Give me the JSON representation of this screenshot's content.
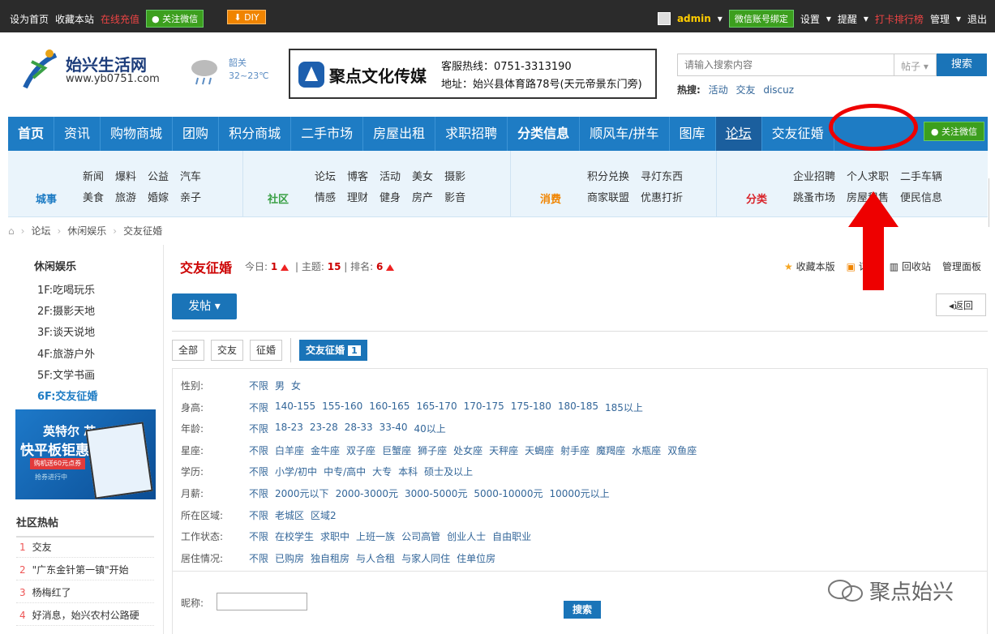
{
  "topbar": {
    "set_home": "设为首页",
    "favorite": "收藏本站",
    "recharge": "在线充值",
    "follow_wechat": "关注微信",
    "diy": "DIY",
    "username": "admin",
    "wechat_bind": "微信账号绑定",
    "settings": "设置",
    "remind": "提醒",
    "ranking": "打卡排行榜",
    "manage": "管理",
    "logout": "退出"
  },
  "header": {
    "site_name": "始兴生活网",
    "site_url": "www.yb0751.com",
    "weather_city": "韶关",
    "weather_temp": "32~23℃",
    "banner_name": "聚点文化传媒",
    "banner_hotline": "客服热线：0751-3313190",
    "banner_address": "地址：始兴县体育路78号(天元帝景东门旁)",
    "search_placeholder": "请输入搜索内容",
    "search_type": "帖子",
    "search_button": "搜索",
    "hot_label": "热搜:",
    "hot_terms": [
      "活动",
      "交友",
      "discuz"
    ]
  },
  "nav": {
    "items": [
      "首页",
      "资讯",
      "购物商城",
      "团购",
      "积分商城",
      "二手市场",
      "房屋出租",
      "求职招聘",
      "分类信息",
      "顺风车/拼车",
      "图库",
      "论坛",
      "交友征婚"
    ],
    "wechat": "关注微信"
  },
  "subnav": {
    "groups": [
      {
        "label": "城事",
        "color": "#1e7cc4",
        "links": [
          "新闻",
          "爆料",
          "公益",
          "汽车",
          "美食",
          "旅游",
          "婚嫁",
          "亲子"
        ]
      },
      {
        "label": "社区",
        "color": "#3aa046",
        "links": [
          "论坛",
          "博客",
          "活动",
          "美女",
          "摄影",
          "情感",
          "理财",
          "健身",
          "房产",
          "影音"
        ]
      },
      {
        "label": "消费",
        "color": "#f08400",
        "links": [
          "积分兑换",
          "寻灯东西",
          "商家联盟",
          "优惠打折"
        ]
      },
      {
        "label": "分类",
        "color": "#d9232a",
        "links": [
          "企业招聘",
          "个人求职",
          "二手车辆",
          "跳蚤市场",
          "房屋租售",
          "便民信息"
        ]
      }
    ]
  },
  "breadcrumb": [
    "论坛",
    "休闲娱乐",
    "交友征婚"
  ],
  "sidebar": {
    "title": "休闲娱乐",
    "boards": [
      "1F:吃喝玩乐",
      "2F:摄影天地",
      "3F:谈天说地",
      "4F:旅游户外",
      "5F:文学书画",
      "6F:交友征婚"
    ],
    "ad": {
      "line1": "英特尔 芯",
      "line2": "快平板钜惠",
      "line3": "购机送60元点券",
      "line4": "抢券进行中"
    },
    "hot_title": "社区热帖",
    "hot_posts": [
      "交友",
      "\"广东金针第一镇\"开始",
      "杨梅红了",
      "好消息，始兴农村公路硬"
    ]
  },
  "forum": {
    "title": "交友征婚",
    "today_label": "今日:",
    "today": "1",
    "topics_label": "主题:",
    "topics": "15",
    "rank_label": "排名:",
    "rank": "6",
    "tools": [
      "收藏本版",
      "订阅",
      "回收站",
      "管理面板"
    ],
    "post_button": "发帖",
    "back_button": "返回",
    "tabs": [
      "全部",
      "交友",
      "征婚"
    ],
    "active_tab": "交友征婚",
    "active_tab_count": "1"
  },
  "filters": [
    {
      "label": "性别:",
      "options": [
        "不限",
        "男",
        "女"
      ]
    },
    {
      "label": "身高:",
      "options": [
        "不限",
        "140-155",
        "155-160",
        "160-165",
        "165-170",
        "170-175",
        "175-180",
        "180-185",
        "185以上"
      ]
    },
    {
      "label": "年龄:",
      "options": [
        "不限",
        "18-23",
        "23-28",
        "28-33",
        "33-40",
        "40以上"
      ]
    },
    {
      "label": "星座:",
      "options": [
        "不限",
        "白羊座",
        "金牛座",
        "双子座",
        "巨蟹座",
        "狮子座",
        "处女座",
        "天秤座",
        "天蝎座",
        "射手座",
        "魔羯座",
        "水瓶座",
        "双鱼座"
      ]
    },
    {
      "label": "学历:",
      "options": [
        "不限",
        "小学/初中",
        "中专/高中",
        "大专",
        "本科",
        "硕士及以上"
      ]
    },
    {
      "label": "月薪:",
      "options": [
        "不限",
        "2000元以下",
        "2000-3000元",
        "3000-5000元",
        "5000-10000元",
        "10000元以上"
      ]
    },
    {
      "label": "所在区域:",
      "options": [
        "不限",
        "老城区",
        "区域2"
      ]
    },
    {
      "label": "工作状态:",
      "options": [
        "不限",
        "在校学生",
        "求职中",
        "上班一族",
        "公司高管",
        "创业人士",
        "自由职业"
      ]
    },
    {
      "label": "居住情况:",
      "options": [
        "不限",
        "已购房",
        "独自租房",
        "与人合租",
        "与家人同住",
        "住单位房"
      ]
    }
  ],
  "nickname": {
    "label": "昵称:",
    "button": "搜索"
  },
  "watermark": "聚点始兴"
}
